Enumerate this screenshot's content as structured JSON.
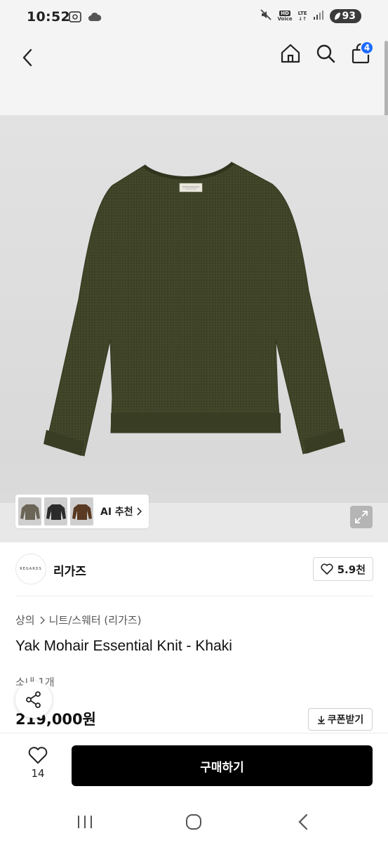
{
  "status_bar": {
    "time": "10:52",
    "battery": "93",
    "hd_label": "HD",
    "voice_label": "Voice",
    "lte_label": "LTE"
  },
  "header": {
    "cart_count": "4"
  },
  "gallery": {
    "ai_recommend_label": "AI 추천",
    "thumb_colors": [
      "#6b6557",
      "#2b2b2b",
      "#5a3a22"
    ],
    "product_color": "#3f4428"
  },
  "brand": {
    "logo_text": "REGARDS",
    "name": "리가즈",
    "likes": "5.9천"
  },
  "product": {
    "breadcrumb": [
      "상의",
      "니트/스웨터 (리가즈)"
    ],
    "title": "Yak Mohair Essential Knit - Khaki",
    "stock": "소내 1개",
    "price": "219,000원",
    "coupon_label": "쿠폰받기"
  },
  "bottom_bar": {
    "wish_count": "14",
    "buy_label": "구매하기"
  }
}
